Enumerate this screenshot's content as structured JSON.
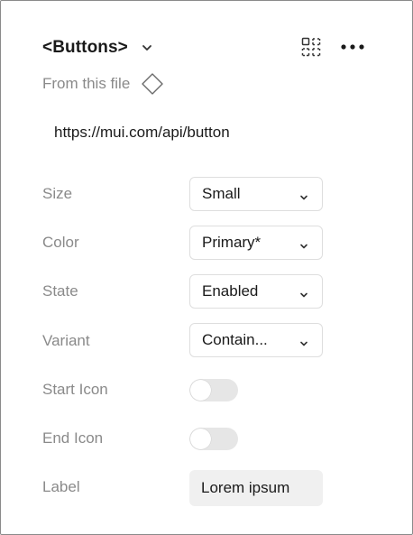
{
  "header": {
    "title": "<Buttons>",
    "chevron_icon": "chevron-down-icon",
    "grid_icon": "grid-select-icon",
    "more_icon": "more-horizontal-icon"
  },
  "source": {
    "label": "From this file",
    "icon": "component-diamond-icon"
  },
  "link": {
    "text": "https://mui.com/api/button"
  },
  "properties": {
    "size": {
      "label": "Size",
      "value": "Small"
    },
    "color": {
      "label": "Color",
      "value": "Primary*"
    },
    "state": {
      "label": "State",
      "value": "Enabled"
    },
    "variant": {
      "label": "Variant",
      "value": "Contain..."
    },
    "start_icon": {
      "label": "Start Icon",
      "enabled": false
    },
    "end_icon": {
      "label": "End Icon",
      "enabled": false
    },
    "label": {
      "label": "Label",
      "value": "Lorem ipsum"
    }
  },
  "colors": {
    "text": "#1a1a1a",
    "muted": "#8a8a8a",
    "toggle_off": "#e6e6e6",
    "input_bg": "#f0f0f0"
  }
}
